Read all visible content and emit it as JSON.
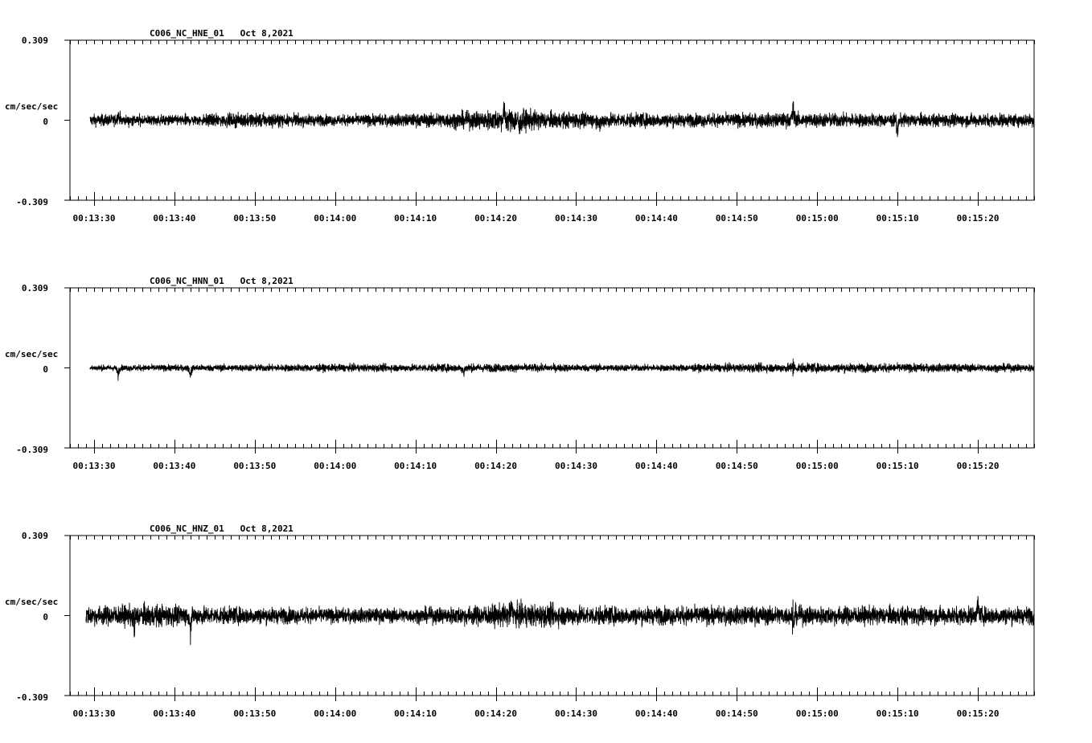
{
  "chart_data": [
    {
      "type": "line",
      "title": "C006_NC_HNE_01   Oct 8,2021",
      "ylabel": "cm/sec/sec",
      "ylim": [
        -0.309,
        0.309
      ],
      "ytick_labels": [
        "0.309",
        "0",
        "-0.309"
      ],
      "xlim": [
        "00:13:27",
        "00:15:27"
      ],
      "xtick_labels": [
        "00:13:30",
        "00:13:40",
        "00:13:50",
        "00:14:00",
        "00:14:10",
        "00:14:20",
        "00:14:30",
        "00:14:40",
        "00:14:50",
        "00:15:00",
        "00:15:10",
        "00:15:20"
      ],
      "trace_start": "00:13:29.5",
      "noise_amplitude": 0.022,
      "envelope": [
        {
          "t": "00:13:30",
          "a": 0.02
        },
        {
          "t": "00:13:40",
          "a": 0.018
        },
        {
          "t": "00:13:50",
          "a": 0.024
        },
        {
          "t": "00:14:00",
          "a": 0.018
        },
        {
          "t": "00:14:10",
          "a": 0.022
        },
        {
          "t": "00:14:17",
          "a": 0.03
        },
        {
          "t": "00:14:22",
          "a": 0.04
        },
        {
          "t": "00:14:27",
          "a": 0.028
        },
        {
          "t": "00:14:35",
          "a": 0.025
        },
        {
          "t": "00:14:45",
          "a": 0.022
        },
        {
          "t": "00:14:58",
          "a": 0.025
        },
        {
          "t": "00:15:10",
          "a": 0.022
        },
        {
          "t": "00:15:27",
          "a": 0.022
        }
      ],
      "peaks": [
        {
          "t": "00:13:33",
          "v": 0.06
        },
        {
          "t": "00:14:21",
          "v": 0.075
        },
        {
          "t": "00:14:23",
          "v": -0.075
        },
        {
          "t": "00:14:33",
          "v": -0.065
        },
        {
          "t": "00:14:57",
          "v": 0.085
        },
        {
          "t": "00:15:10",
          "v": -0.065
        }
      ],
      "grid": false
    },
    {
      "type": "line",
      "title": "C006_NC_HNN_01   Oct 8,2021",
      "ylabel": "cm/sec/sec",
      "ylim": [
        -0.309,
        0.309
      ],
      "ytick_labels": [
        "0.309",
        "0",
        "-0.309"
      ],
      "xlim": [
        "00:13:27",
        "00:15:27"
      ],
      "xtick_labels": [
        "00:13:30",
        "00:13:40",
        "00:13:50",
        "00:14:00",
        "00:14:10",
        "00:14:20",
        "00:14:30",
        "00:14:40",
        "00:14:50",
        "00:15:00",
        "00:15:10",
        "00:15:20"
      ],
      "trace_start": "00:13:29.5",
      "noise_amplitude": 0.012,
      "envelope": [
        {
          "t": "00:13:30",
          "a": 0.01
        },
        {
          "t": "00:13:50",
          "a": 0.012
        },
        {
          "t": "00:14:10",
          "a": 0.013
        },
        {
          "t": "00:14:20",
          "a": 0.014
        },
        {
          "t": "00:14:40",
          "a": 0.011
        },
        {
          "t": "00:14:57",
          "a": 0.016
        },
        {
          "t": "00:15:27",
          "a": 0.013
        }
      ],
      "peaks": [
        {
          "t": "00:13:33",
          "v": -0.055
        },
        {
          "t": "00:13:42",
          "v": -0.05
        },
        {
          "t": "00:14:16",
          "v": -0.04
        },
        {
          "t": "00:14:57",
          "v": 0.075
        },
        {
          "t": "00:14:57",
          "v": -0.06
        }
      ],
      "grid": false
    },
    {
      "type": "line",
      "title": "C006_NC_HNZ_01   Oct 8,2021",
      "ylabel": "cm/sec/sec",
      "ylim": [
        -0.309,
        0.309
      ],
      "ytick_labels": [
        "0.309",
        "0",
        "-0.309"
      ],
      "xlim": [
        "00:13:27",
        "00:15:27"
      ],
      "xtick_labels": [
        "00:13:30",
        "00:13:40",
        "00:13:50",
        "00:14:00",
        "00:14:10",
        "00:14:20",
        "00:14:30",
        "00:14:40",
        "00:14:50",
        "00:15:00",
        "00:15:10",
        "00:15:20"
      ],
      "trace_start": "00:13:29",
      "noise_amplitude": 0.03,
      "envelope": [
        {
          "t": "00:13:30",
          "a": 0.032
        },
        {
          "t": "00:13:37",
          "a": 0.038
        },
        {
          "t": "00:13:45",
          "a": 0.03
        },
        {
          "t": "00:14:00",
          "a": 0.025
        },
        {
          "t": "00:14:10",
          "a": 0.025
        },
        {
          "t": "00:14:23",
          "a": 0.04
        },
        {
          "t": "00:14:35",
          "a": 0.03
        },
        {
          "t": "00:14:57",
          "a": 0.032
        },
        {
          "t": "00:15:20",
          "a": 0.03
        },
        {
          "t": "00:15:27",
          "a": 0.03
        }
      ],
      "peaks": [
        {
          "t": "00:13:35",
          "v": -0.13
        },
        {
          "t": "00:13:35",
          "v": 0.09
        },
        {
          "t": "00:13:42",
          "v": -0.11
        },
        {
          "t": "00:14:22",
          "v": 0.08
        },
        {
          "t": "00:14:57",
          "v": -0.14
        },
        {
          "t": "00:14:57",
          "v": 0.1
        },
        {
          "t": "00:15:20",
          "v": 0.08
        }
      ],
      "grid": false
    }
  ]
}
